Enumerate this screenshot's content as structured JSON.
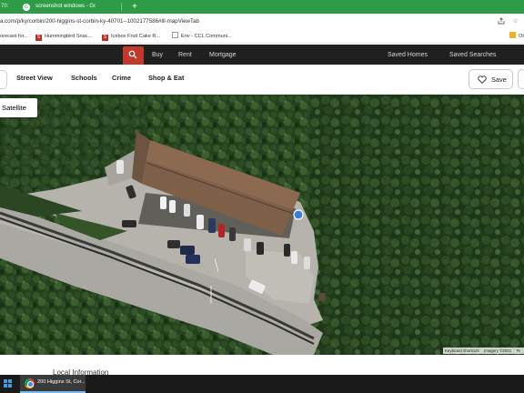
{
  "browser": {
    "tabs": [
      {
        "title": "70:",
        "active": false
      },
      {
        "title": "screenshot windows - Google Se",
        "active": true
      }
    ],
    "close_glyph": "×",
    "new_tab_glyph": "+",
    "url": "a.com/p/ky/corbin/200-higgins-st-corbin-ky-40701--1002177586#lil-mapViewTab",
    "bookmarks": [
      {
        "label": "orecast for...",
        "icon": "weather-icon"
      },
      {
        "label": "Hummingbird Snac...",
        "icon": "sl-icon"
      },
      {
        "label": "Icebox Fruit Cake R...",
        "icon": "sl-icon"
      },
      {
        "label": "Env - CCL Communi...",
        "icon": "page-icon"
      },
      {
        "label": "Ot",
        "icon": "folder-icon"
      }
    ]
  },
  "site": {
    "dark_nav": [
      "Buy",
      "Rent",
      "Mortgage",
      "Saved Homes",
      "Saved Searches"
    ],
    "subnav": [
      "Street View",
      "Schools",
      "Crime",
      "Shop & Eat"
    ],
    "save_label": "Save"
  },
  "map": {
    "satellite_label": "Satellite",
    "attribution": [
      "Keyboard shortcuts",
      "Imagery ©2021",
      "Te"
    ]
  },
  "below_map": {
    "heading": "Local Information"
  },
  "taskbar": {
    "item_label": "200 Higgins St, Cor..."
  },
  "colors": {
    "chrome_green": "#2e9c46",
    "site_dark": "#202020",
    "search_red": "#c0392b"
  }
}
